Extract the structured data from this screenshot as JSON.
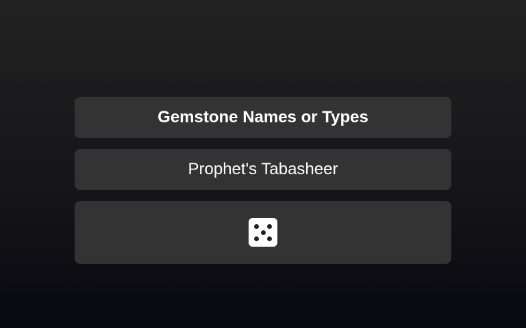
{
  "category": {
    "title": "Gemstone Names or Types"
  },
  "result": {
    "text": "Prophet's Tabasheer"
  },
  "dice": {
    "icon": "dice-five-icon",
    "face_value": 5
  },
  "colors": {
    "panel": "#333333",
    "background_top": "#222222",
    "background_bottom": "#080810",
    "text": "#ffffff"
  }
}
